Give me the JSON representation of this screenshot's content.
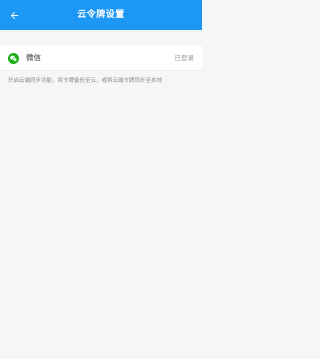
{
  "header": {
    "title": "云令牌设置",
    "back_icon": "arrow-left-icon",
    "background_color": "#1c97f3"
  },
  "account": {
    "icon": "wechat-icon",
    "icon_color": "#1aad19",
    "label": "微信",
    "status": "已登录"
  },
  "description": "开启云端同步功能，将令牌备份至云，或将云端令牌同步至本地"
}
